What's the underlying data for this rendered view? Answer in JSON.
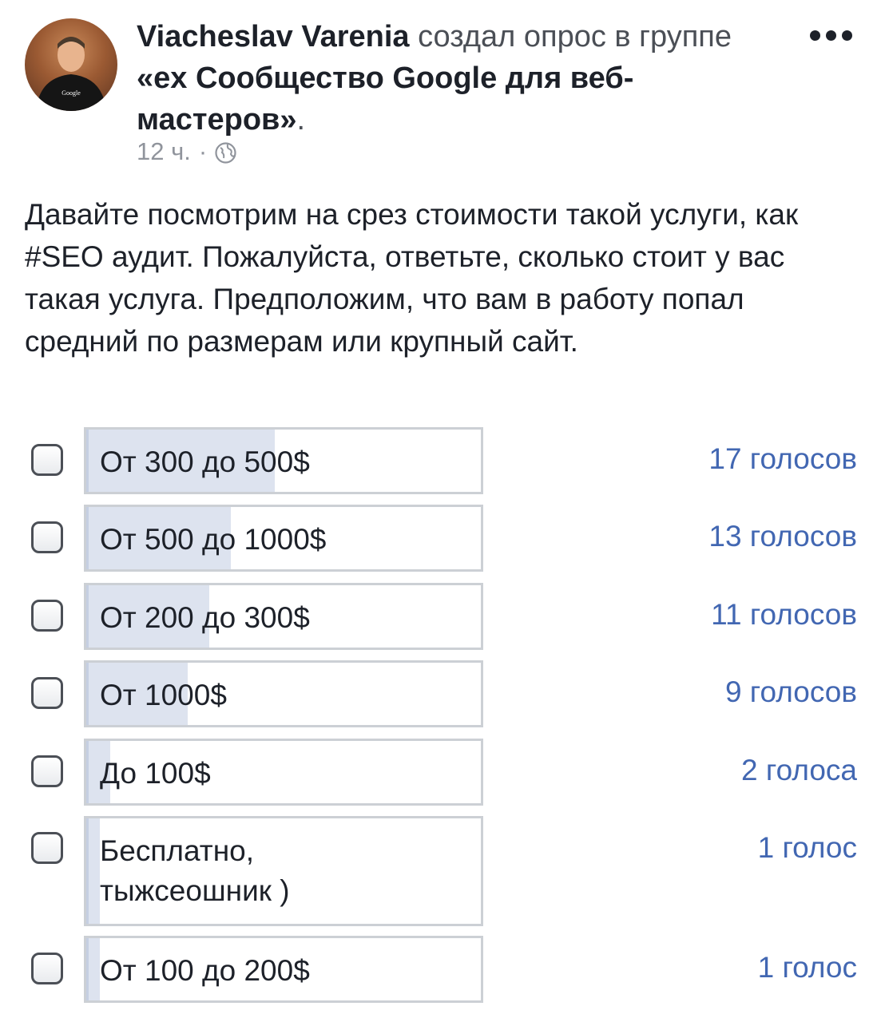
{
  "post": {
    "author": "Viacheslav Varenia",
    "action": "создал опрос в группе",
    "group": "«ex Сообщество Google для веб-мастеров»",
    "time": "12 ч.",
    "separator": "·",
    "privacy_icon": "globe-icon",
    "more_icon": "more-options-icon",
    "text": "Давайте посмотрим на срез стоимости такой услуги, как #SEO аудит. Пожалуйста, ответьте, сколько стоит у вас такая услуга. Предположим, что вам в работу попал средний по размерам или крупный сайт."
  },
  "poll": {
    "options": [
      {
        "label": "От 300 до 500$",
        "votes": "17 голосов",
        "count": 17
      },
      {
        "label": "От 500 до 1000$",
        "votes": "13 голосов",
        "count": 13
      },
      {
        "label": "От 200 до 300$",
        "votes": "11 голосов",
        "count": 11
      },
      {
        "label": "От 1000$",
        "votes": "9 голосов",
        "count": 9
      },
      {
        "label": "До 100$",
        "votes": "2 голоса",
        "count": 2
      },
      {
        "label": "Бесплатно, тыжсеошник )",
        "votes": "1 голос",
        "count": 1
      },
      {
        "label": "От 100 до 200$",
        "votes": "1 голос",
        "count": 1
      }
    ],
    "max_count": 54
  },
  "colors": {
    "bar_fill": "#dde3ef",
    "votes_text": "#4267b2"
  }
}
